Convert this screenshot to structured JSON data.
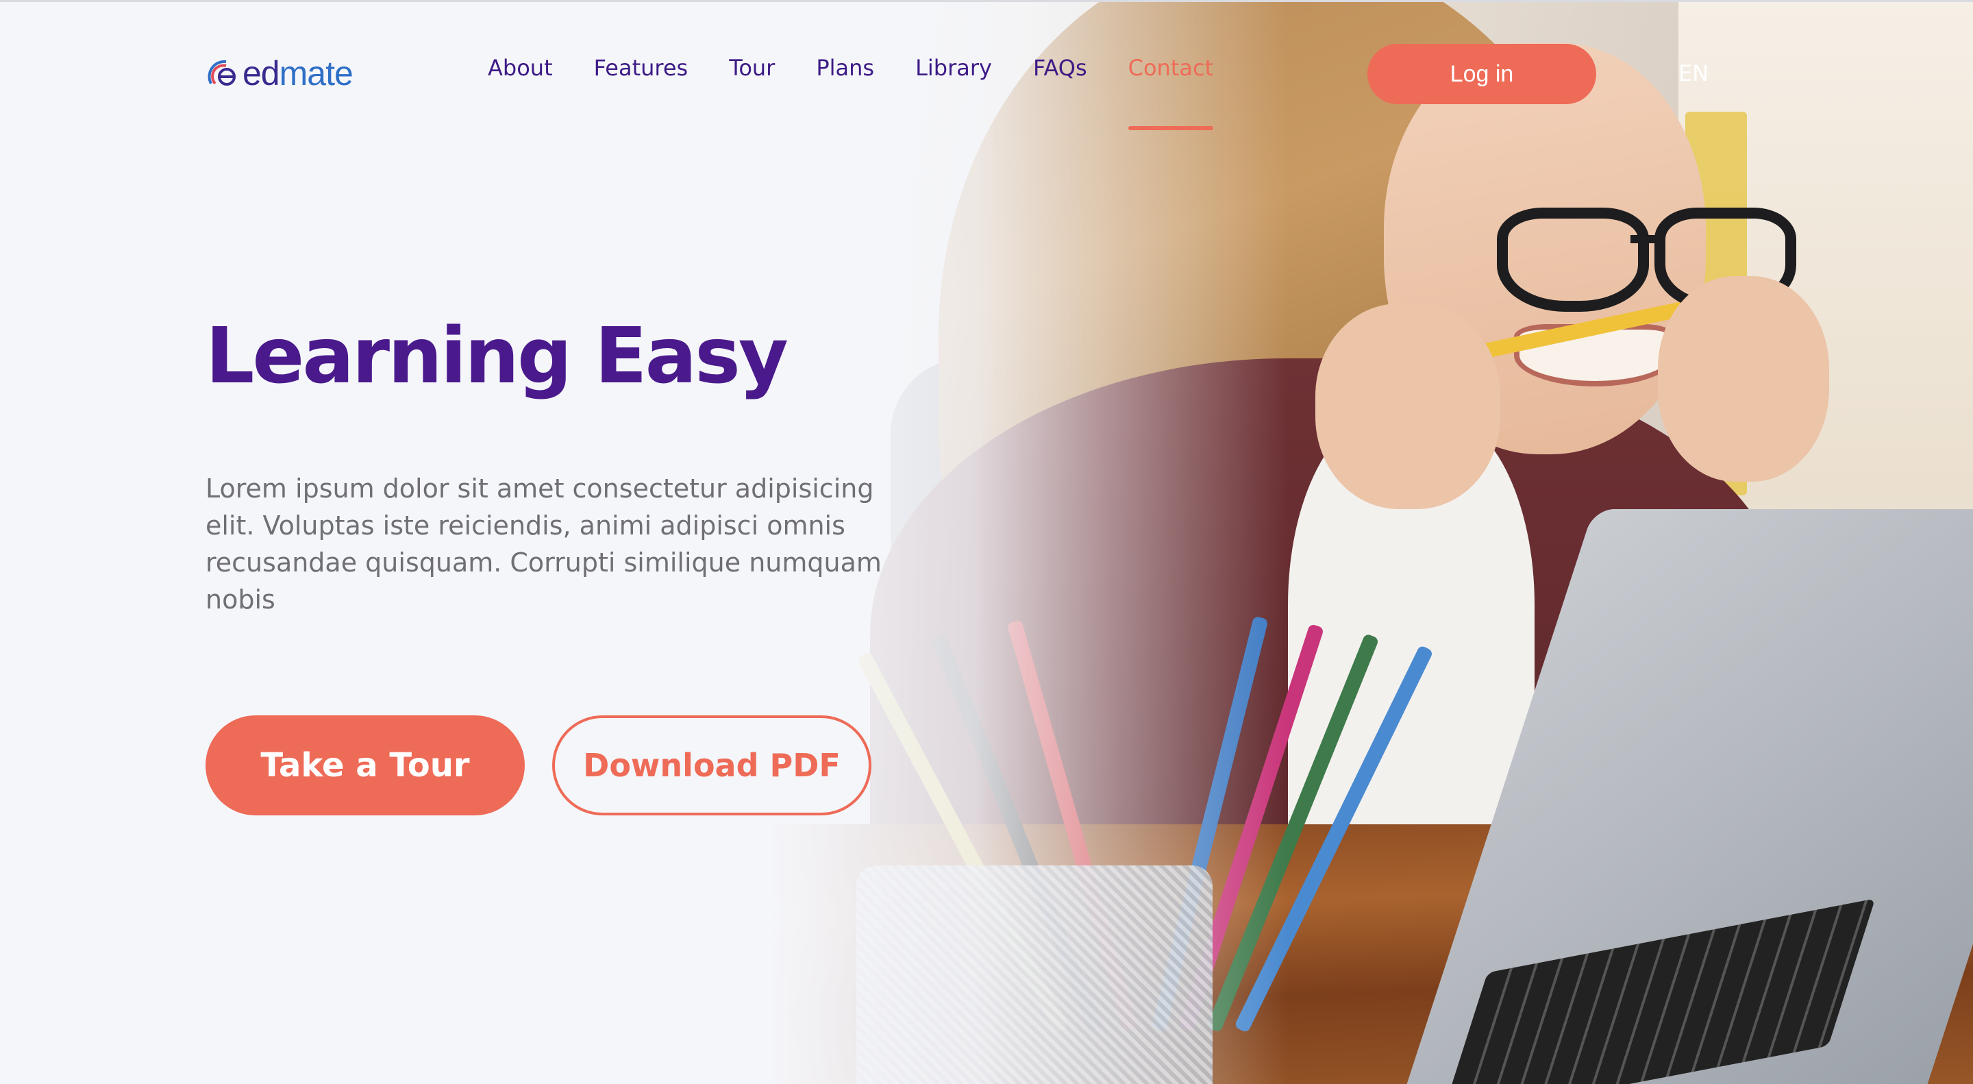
{
  "brand": {
    "name_part1": "ed",
    "name_part2": "mate",
    "icon": "edmate-logo-icon"
  },
  "nav": {
    "items": [
      {
        "label": "About"
      },
      {
        "label": "Features"
      },
      {
        "label": "Tour"
      },
      {
        "label": "Plans"
      },
      {
        "label": "Library"
      },
      {
        "label": "FAQs"
      },
      {
        "label": "Contact",
        "active": true
      }
    ]
  },
  "header": {
    "login_label": "Log in",
    "language": "EN"
  },
  "hero": {
    "title": "Learning Easy",
    "body": "Lorem ipsum dolor sit amet consectetur adipisicing elit. Voluptas iste reiciendis, animi adipisci omnis recusandae quisquam. Corrupti similique numquam nobis",
    "primary_cta": "Take a Tour",
    "secondary_cta": "Download PDF"
  },
  "colors": {
    "accent": "#ee6b57",
    "primary_text": "#4a1a8c",
    "nav_text": "#3d1b86",
    "body_text": "#6f6f75",
    "background": "#f5f6fa"
  }
}
